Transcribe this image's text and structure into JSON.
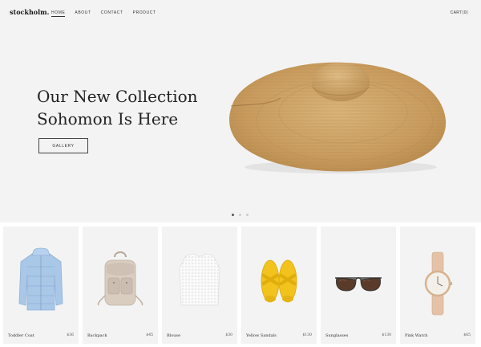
{
  "header": {
    "logo": "stockholm.",
    "nav": [
      "HOME",
      "ABOUT",
      "CONTACT",
      "PRODUCT"
    ],
    "cart": "CART(0)"
  },
  "hero": {
    "title_line1": "Our New Collection",
    "title_line2": "Sohomon Is Here",
    "button": "GALLERY",
    "image": "straw-hat-image",
    "slides": 3,
    "active_slide": 1
  },
  "products": [
    {
      "name": "Toddler Coat",
      "price": "$36",
      "image": "coat-image"
    },
    {
      "name": "Backpack",
      "price": "$45",
      "image": "backpack-image"
    },
    {
      "name": "Blouse",
      "price": "$30",
      "image": "blouse-image"
    },
    {
      "name": "Yellow Sandals",
      "price": "$130",
      "image": "sandals-image"
    },
    {
      "name": "Sunglasses",
      "price": "$130",
      "image": "sunglasses-image"
    },
    {
      "name": "Pink Watch",
      "price": "$65",
      "image": "watch-image"
    }
  ]
}
